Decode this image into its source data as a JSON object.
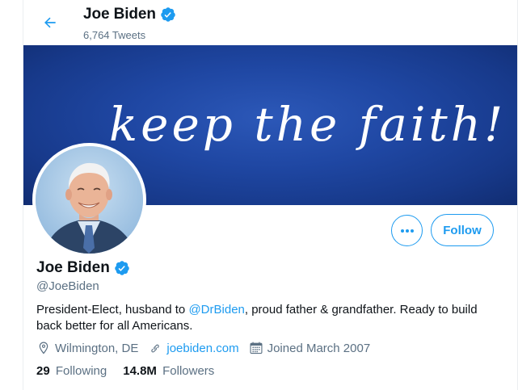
{
  "header": {
    "name": "Joe Biden",
    "tweet_count": "6,764 Tweets"
  },
  "banner": {
    "text": "keep the faith!"
  },
  "actions": {
    "more_label": "•••",
    "follow_label": "Follow"
  },
  "profile": {
    "name": "Joe Biden",
    "handle": "@JoeBiden",
    "bio_before": "President-Elect, husband to ",
    "bio_mention": "@DrBiden",
    "bio_after": ", proud father & grandfather. Ready to build back better for all Americans.",
    "location": "Wilmington, DE",
    "website": "joebiden.com",
    "joined": "Joined March 2007",
    "following_count": "29",
    "following_label": "Following",
    "followers_count": "14.8M",
    "followers_label": "Followers"
  },
  "icons": {
    "back": "arrow-left-icon",
    "verified": "verified-badge-icon",
    "more": "more-icon",
    "location": "location-pin-icon",
    "link": "link-icon",
    "calendar": "calendar-icon"
  },
  "colors": {
    "accent": "#1d9bf0",
    "secondary_text": "#5b7083",
    "banner": "#1f47a3"
  }
}
